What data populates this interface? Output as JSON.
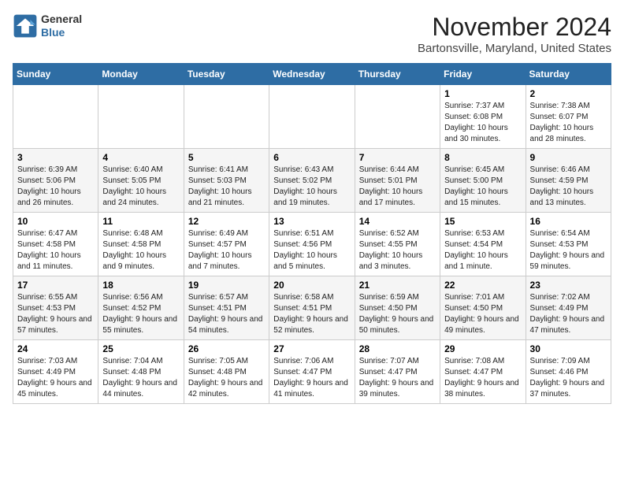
{
  "header": {
    "logo_line1": "General",
    "logo_line2": "Blue",
    "month_title": "November 2024",
    "location": "Bartonsville, Maryland, United States"
  },
  "weekdays": [
    "Sunday",
    "Monday",
    "Tuesday",
    "Wednesday",
    "Thursday",
    "Friday",
    "Saturday"
  ],
  "weeks": [
    [
      {
        "day": "",
        "info": ""
      },
      {
        "day": "",
        "info": ""
      },
      {
        "day": "",
        "info": ""
      },
      {
        "day": "",
        "info": ""
      },
      {
        "day": "",
        "info": ""
      },
      {
        "day": "1",
        "info": "Sunrise: 7:37 AM\nSunset: 6:08 PM\nDaylight: 10 hours and 30 minutes."
      },
      {
        "day": "2",
        "info": "Sunrise: 7:38 AM\nSunset: 6:07 PM\nDaylight: 10 hours and 28 minutes."
      }
    ],
    [
      {
        "day": "3",
        "info": "Sunrise: 6:39 AM\nSunset: 5:06 PM\nDaylight: 10 hours and 26 minutes."
      },
      {
        "day": "4",
        "info": "Sunrise: 6:40 AM\nSunset: 5:05 PM\nDaylight: 10 hours and 24 minutes."
      },
      {
        "day": "5",
        "info": "Sunrise: 6:41 AM\nSunset: 5:03 PM\nDaylight: 10 hours and 21 minutes."
      },
      {
        "day": "6",
        "info": "Sunrise: 6:43 AM\nSunset: 5:02 PM\nDaylight: 10 hours and 19 minutes."
      },
      {
        "day": "7",
        "info": "Sunrise: 6:44 AM\nSunset: 5:01 PM\nDaylight: 10 hours and 17 minutes."
      },
      {
        "day": "8",
        "info": "Sunrise: 6:45 AM\nSunset: 5:00 PM\nDaylight: 10 hours and 15 minutes."
      },
      {
        "day": "9",
        "info": "Sunrise: 6:46 AM\nSunset: 4:59 PM\nDaylight: 10 hours and 13 minutes."
      }
    ],
    [
      {
        "day": "10",
        "info": "Sunrise: 6:47 AM\nSunset: 4:58 PM\nDaylight: 10 hours and 11 minutes."
      },
      {
        "day": "11",
        "info": "Sunrise: 6:48 AM\nSunset: 4:58 PM\nDaylight: 10 hours and 9 minutes."
      },
      {
        "day": "12",
        "info": "Sunrise: 6:49 AM\nSunset: 4:57 PM\nDaylight: 10 hours and 7 minutes."
      },
      {
        "day": "13",
        "info": "Sunrise: 6:51 AM\nSunset: 4:56 PM\nDaylight: 10 hours and 5 minutes."
      },
      {
        "day": "14",
        "info": "Sunrise: 6:52 AM\nSunset: 4:55 PM\nDaylight: 10 hours and 3 minutes."
      },
      {
        "day": "15",
        "info": "Sunrise: 6:53 AM\nSunset: 4:54 PM\nDaylight: 10 hours and 1 minute."
      },
      {
        "day": "16",
        "info": "Sunrise: 6:54 AM\nSunset: 4:53 PM\nDaylight: 9 hours and 59 minutes."
      }
    ],
    [
      {
        "day": "17",
        "info": "Sunrise: 6:55 AM\nSunset: 4:53 PM\nDaylight: 9 hours and 57 minutes."
      },
      {
        "day": "18",
        "info": "Sunrise: 6:56 AM\nSunset: 4:52 PM\nDaylight: 9 hours and 55 minutes."
      },
      {
        "day": "19",
        "info": "Sunrise: 6:57 AM\nSunset: 4:51 PM\nDaylight: 9 hours and 54 minutes."
      },
      {
        "day": "20",
        "info": "Sunrise: 6:58 AM\nSunset: 4:51 PM\nDaylight: 9 hours and 52 minutes."
      },
      {
        "day": "21",
        "info": "Sunrise: 6:59 AM\nSunset: 4:50 PM\nDaylight: 9 hours and 50 minutes."
      },
      {
        "day": "22",
        "info": "Sunrise: 7:01 AM\nSunset: 4:50 PM\nDaylight: 9 hours and 49 minutes."
      },
      {
        "day": "23",
        "info": "Sunrise: 7:02 AM\nSunset: 4:49 PM\nDaylight: 9 hours and 47 minutes."
      }
    ],
    [
      {
        "day": "24",
        "info": "Sunrise: 7:03 AM\nSunset: 4:49 PM\nDaylight: 9 hours and 45 minutes."
      },
      {
        "day": "25",
        "info": "Sunrise: 7:04 AM\nSunset: 4:48 PM\nDaylight: 9 hours and 44 minutes."
      },
      {
        "day": "26",
        "info": "Sunrise: 7:05 AM\nSunset: 4:48 PM\nDaylight: 9 hours and 42 minutes."
      },
      {
        "day": "27",
        "info": "Sunrise: 7:06 AM\nSunset: 4:47 PM\nDaylight: 9 hours and 41 minutes."
      },
      {
        "day": "28",
        "info": "Sunrise: 7:07 AM\nSunset: 4:47 PM\nDaylight: 9 hours and 39 minutes."
      },
      {
        "day": "29",
        "info": "Sunrise: 7:08 AM\nSunset: 4:47 PM\nDaylight: 9 hours and 38 minutes."
      },
      {
        "day": "30",
        "info": "Sunrise: 7:09 AM\nSunset: 4:46 PM\nDaylight: 9 hours and 37 minutes."
      }
    ]
  ]
}
